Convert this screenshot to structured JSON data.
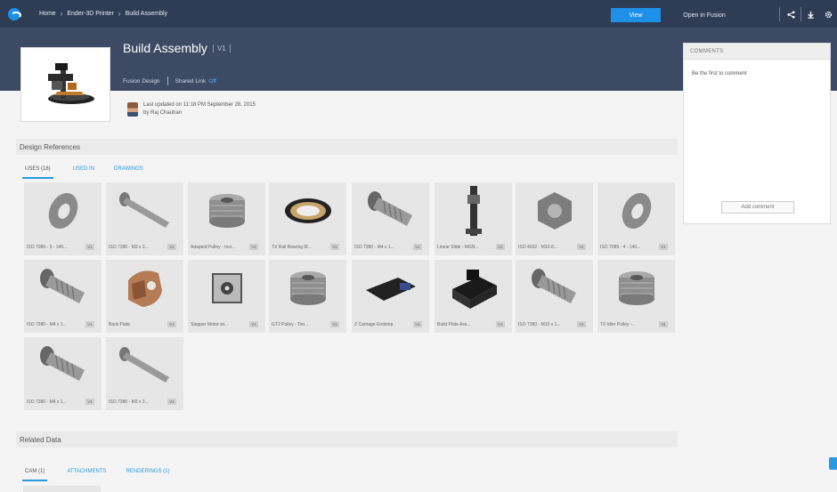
{
  "topbar": {
    "breadcrumbs": [
      "Home",
      "Ender-3D Printer",
      "Build Assembly"
    ],
    "view_label": "View",
    "open_label": "Open in Fusion"
  },
  "header": {
    "title": "Build Assembly",
    "version": "V1",
    "subtitle_left": "Fusion Design",
    "subtitle_share": "Shared Link",
    "subtitle_share_state": "Off"
  },
  "updated": {
    "line1": "Last updated on 11:18 PM September 28, 2015",
    "line2": "by Raj Chauhan"
  },
  "comments": {
    "header": "COMMENTS",
    "empty_text": "Be the first to comment",
    "add_label": "Add comment"
  },
  "design_refs": {
    "title": "Design References",
    "tabs": [
      "USES (18)",
      "USED IN",
      "DRAWINGS"
    ]
  },
  "parts": [
    {
      "label": "ISO 7089 - 3 - 140...",
      "badge": "V1",
      "icon": "washer"
    },
    {
      "label": "ISO 7380 - M3 x 3...",
      "badge": "V1",
      "icon": "screw"
    },
    {
      "label": "Adapted Pulley - Insi...",
      "badge": "V1",
      "icon": "pulley"
    },
    {
      "label": "TX Rail Bearing M...",
      "badge": "V1",
      "icon": "bearing"
    },
    {
      "label": "ISO 7380 - M4 x 1...",
      "badge": "V1",
      "icon": "bolt"
    },
    {
      "label": "Linear Slide - MGN...",
      "badge": "V1",
      "icon": "rail"
    },
    {
      "label": "ISO 4032 - M10-8...",
      "badge": "V1",
      "icon": "nut"
    },
    {
      "label": "ISO 7089 - 4 - 140...",
      "badge": "V1",
      "icon": "washer"
    },
    {
      "label": "ISO 7380 - M4 x 1...",
      "badge": "V1",
      "icon": "bolt"
    },
    {
      "label": "Back Plate",
      "badge": "V1",
      "icon": "bracket"
    },
    {
      "label": "Stepper Motor wi...",
      "badge": "V1",
      "icon": "motor"
    },
    {
      "label": "GT2 Pulley - Ton...",
      "badge": "V1",
      "icon": "pulley"
    },
    {
      "label": "Z Carriage Endstop",
      "badge": "V1",
      "icon": "board"
    },
    {
      "label": "Build Plate Ass...",
      "badge": "V1",
      "icon": "block"
    },
    {
      "label": "ISO 7380 - M10 x 1...",
      "badge": "V1",
      "icon": "bolt"
    },
    {
      "label": "TX Idler Pulley -...",
      "badge": "V1",
      "icon": "pulley"
    },
    {
      "label": "ISO 7380 - M4 x 1...",
      "badge": "V1",
      "icon": "bolt"
    },
    {
      "label": "ISO 7380 - M3 x 3...",
      "badge": "V1",
      "icon": "screw"
    }
  ],
  "related": {
    "title": "Related Data",
    "tabs": [
      "CAM (1)",
      "ATTACHMENTS",
      "RENDERINGS (1)"
    ]
  },
  "colors": {
    "topbar": "#2e3c54",
    "header": "#3d4a64",
    "accent": "#1e90e8"
  }
}
